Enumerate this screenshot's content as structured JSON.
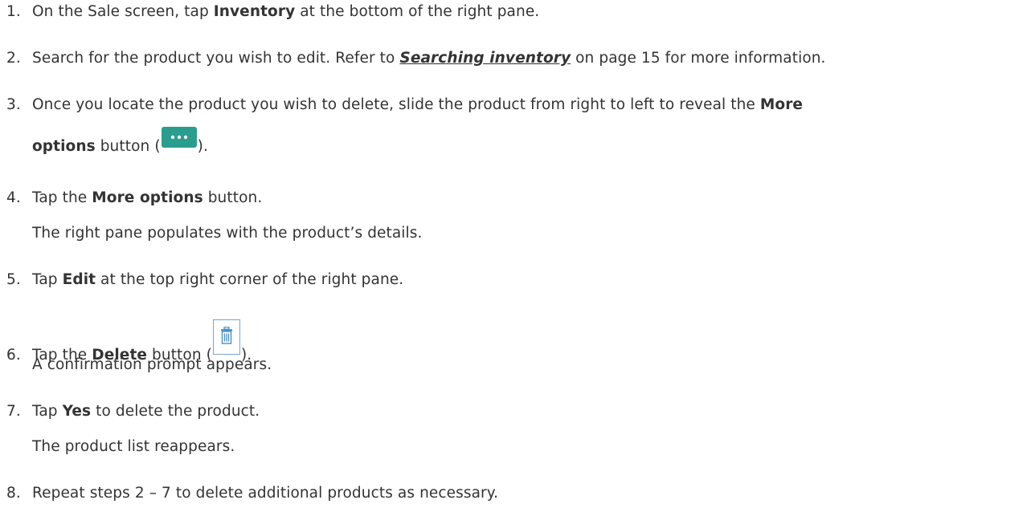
{
  "steps": [
    {
      "num": "1.",
      "t1": "On the Sale screen, tap ",
      "b1": "Inventory",
      "t2": " at the bottom of the right pane."
    },
    {
      "num": "2.",
      "t1": "Search for the product you wish to edit. Refer to ",
      "link": "Searching inventory",
      "t2": " on page 15 for more information."
    },
    {
      "num": "3.",
      "t1": "Once you locate the product you wish to delete, slide the product from right to left to reveal the ",
      "b1": "More",
      "b2": "options",
      "t2": " button (",
      "t3": ")."
    },
    {
      "num": "4.",
      "t1": "Tap the ",
      "b1": "More options",
      "t2": " button.",
      "note": "The right pane populates with the product’s details."
    },
    {
      "num": "5.",
      "t1": "Tap ",
      "b1": "Edit",
      "t2": " at the top right corner of the right pane."
    },
    {
      "num": "6.",
      "t1": "Tap the ",
      "b1": "Delete",
      "t2": " button (",
      "t3": ").",
      "note": "A confirmation prompt appears."
    },
    {
      "num": "7.",
      "t1": "Tap ",
      "b1": "Yes",
      "t2": " to delete the product.",
      "note": "The product list reappears."
    },
    {
      "num": "8.",
      "t1": "Repeat steps 2 – 7 to delete additional products as necessary."
    }
  ],
  "icons": {
    "more_options": "more-options-icon",
    "delete": "trash-icon"
  },
  "colors": {
    "more_button_bg": "#2a9d8f",
    "delete_button_border": "#7aa7c7",
    "text": "#333333"
  }
}
